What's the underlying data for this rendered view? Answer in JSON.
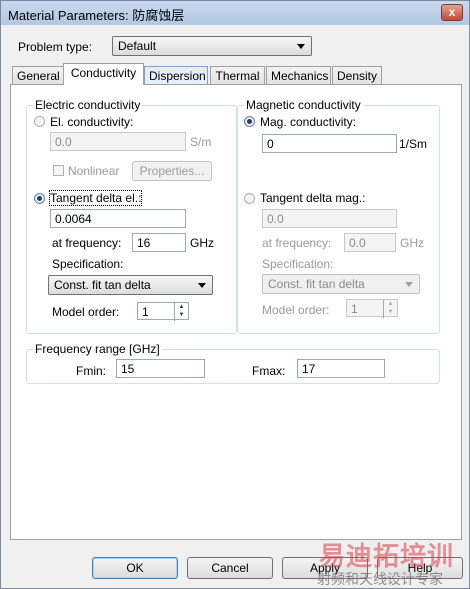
{
  "window": {
    "title": "Material Parameters: 防腐蚀层",
    "close_glyph": "x"
  },
  "problem_type": {
    "label": "Problem type:",
    "value": "Default"
  },
  "tabs": [
    {
      "label": "General"
    },
    {
      "label": "Conductivity"
    },
    {
      "label": "Dispersion"
    },
    {
      "label": "Thermal"
    },
    {
      "label": "Mechanics"
    },
    {
      "label": "Density"
    }
  ],
  "electric": {
    "group_title": "Electric conductivity",
    "el_conductivity_label": "El. conductivity:",
    "el_conductivity_value": "0.0",
    "el_conductivity_unit": "S/m",
    "nonlinear_label": "Nonlinear",
    "properties_label": "Properties...",
    "tangent_delta_label": "Tangent delta el.:",
    "tangent_delta_value": "0.0064",
    "at_frequency_label": "at frequency:",
    "at_frequency_value": "16",
    "at_frequency_unit": "GHz",
    "specification_label": "Specification:",
    "specification_value": "Const. fit tan delta",
    "model_order_label": "Model order:",
    "model_order_value": "1"
  },
  "magnetic": {
    "group_title": "Magnetic conductivity",
    "mag_conductivity_label": "Mag. conductivity:",
    "mag_conductivity_value": "0",
    "mag_conductivity_unit": "1/Sm",
    "tangent_delta_label": "Tangent delta mag.:",
    "tangent_delta_value": "0.0",
    "at_frequency_label": "at frequency:",
    "at_frequency_value": "0.0",
    "at_frequency_unit": "GHz",
    "specification_label": "Specification:",
    "specification_value": "Const. fit tan delta",
    "model_order_label": "Model order:",
    "model_order_value": "1"
  },
  "frequency_range": {
    "group_title": "Frequency range [GHz]",
    "fmin_label": "Fmin:",
    "fmin_value": "15",
    "fmax_label": "Fmax:",
    "fmax_value": "17"
  },
  "buttons": {
    "ok": "OK",
    "cancel": "Cancel",
    "apply": "Apply",
    "help": "Help"
  },
  "watermark": {
    "line1": "易迪拓培训",
    "line2": "射频和天线设计专家"
  }
}
